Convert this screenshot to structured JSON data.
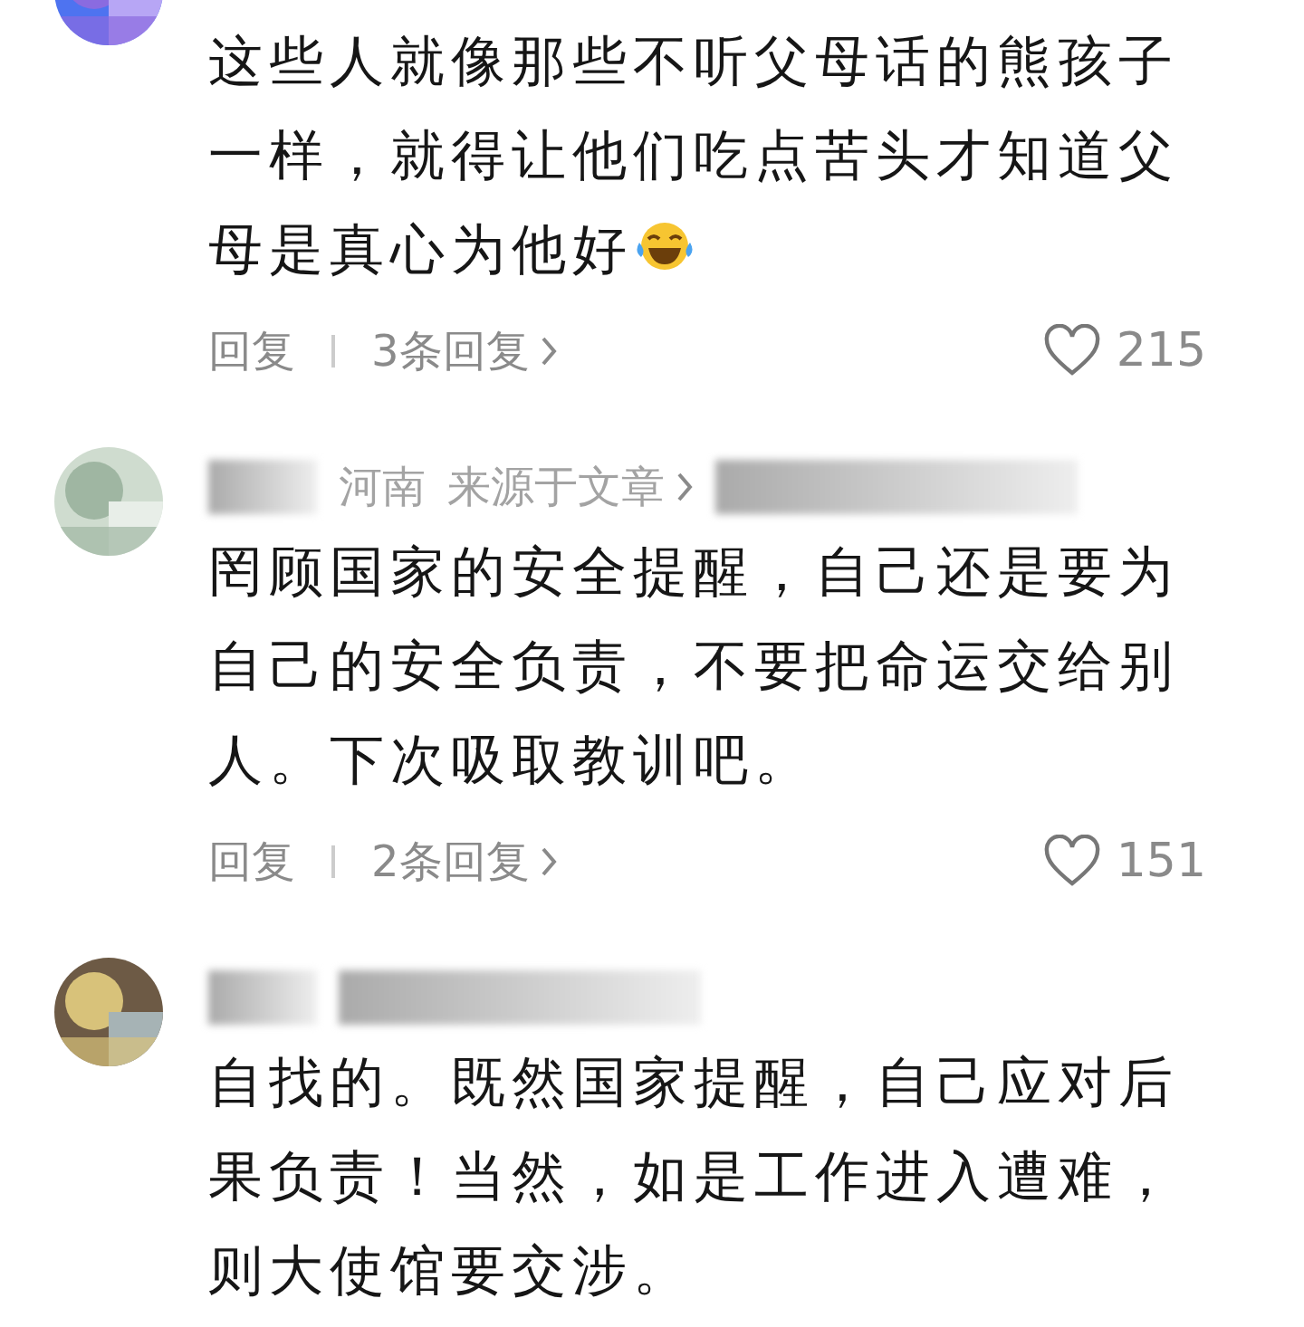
{
  "comments": [
    {
      "text": "这些人就像那些不听父母话的熊孩子一样，就得让他们吃点苦头才知道父母是真心为他好",
      "emoji": true,
      "reply_label": "回复",
      "replies": "3条回复",
      "likes": "215"
    },
    {
      "header": {
        "location": "河南",
        "source": "来源于文章",
        "redacted": true
      },
      "text": "罔顾国家的安全提醒，自己还是要为自己的安全负责，不要把命运交给别人。下次吸取教训吧。",
      "reply_label": "回复",
      "replies": "2条回复",
      "likes": "151"
    },
    {
      "header": {
        "redacted": true
      },
      "text": "自找的。既然国家提醒，自己应对后果负责！当然，如是工作进入遭难，则大使馆要交涉。"
    }
  ]
}
